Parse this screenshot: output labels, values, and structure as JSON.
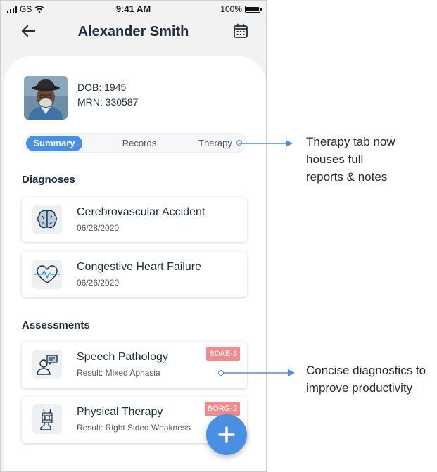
{
  "status_bar": {
    "carrier": "GS",
    "time": "9:41 AM",
    "battery": "100%"
  },
  "header": {
    "title": "Alexander Smith",
    "back_icon": "arrow-left-icon",
    "calendar_icon": "calendar-icon"
  },
  "patient": {
    "dob": "DOB: 1945",
    "mrn": "MRN: 330587"
  },
  "tabs": [
    {
      "label": "Summary",
      "active": true
    },
    {
      "label": "Records",
      "active": false
    },
    {
      "label": "Therapy",
      "active": false
    }
  ],
  "diagnoses": {
    "title": "Diagnoses",
    "items": [
      {
        "name": "Cerebrovascular Accident",
        "date": "06/28/2020",
        "icon": "brain-icon"
      },
      {
        "name": "Congestive Heart Failure",
        "date": "06/26/2020",
        "icon": "heart-pulse-icon"
      }
    ]
  },
  "assessments": {
    "title": "Assessments",
    "items": [
      {
        "name": "Speech Pathology",
        "result": "Result: Mixed Aphasia",
        "badge": "BDAE-3",
        "icon": "speech-person-icon"
      },
      {
        "name": "Physical Therapy",
        "result": "Result: Right Sided Weakness",
        "badge": "BORG-2",
        "icon": "leg-brace-icon"
      }
    ]
  },
  "fab": {
    "icon": "plus-icon"
  },
  "annotations": {
    "therapy_line1": "Therapy tab now",
    "therapy_line2": "houses full",
    "therapy_line3": "reports & notes",
    "diagnostics_line1": "Concise diagnostics to",
    "diagnostics_line2": "improve productivity"
  },
  "colors": {
    "accent": "#4a8fe2",
    "badge": "#f28b8b",
    "text": "#1f2d3d"
  }
}
